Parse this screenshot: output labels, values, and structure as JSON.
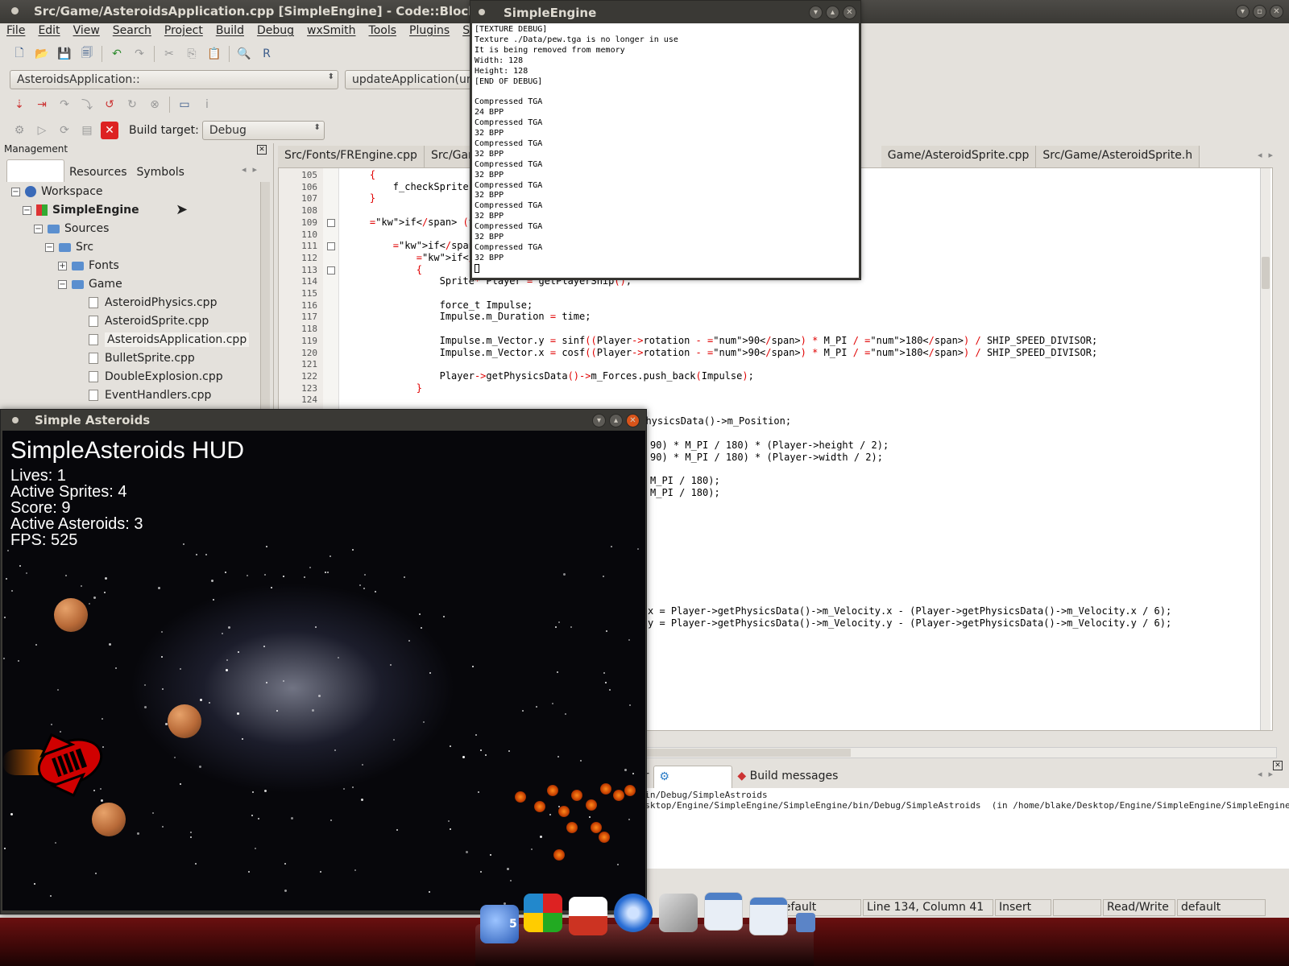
{
  "codeblocks": {
    "title": "Src/Game/AsteroidsApplication.cpp [SimpleEngine] - Code::Blocks 8.02",
    "menu": [
      "File",
      "Edit",
      "View",
      "Search",
      "Project",
      "Build",
      "Debug",
      "wxSmith",
      "Tools",
      "Plugins",
      "Setti"
    ],
    "scope_combo": "AsteroidsApplication::",
    "function_combo": "updateApplication(uns",
    "build_target_label": "Build target:",
    "build_target_value": "Debug",
    "management": {
      "header": "Management",
      "tabs": [
        "",
        "Resources",
        "Symbols"
      ],
      "tree": {
        "workspace": "Workspace",
        "project": "SimpleEngine",
        "sources": "Sources",
        "src": "Src",
        "fonts": "Fonts",
        "game": "Game",
        "files": [
          "AsteroidPhysics.cpp",
          "AsteroidSprite.cpp",
          "AsteroidsApplication.cpp",
          "BulletSprite.cpp",
          "DoubleExplosion.cpp",
          "EventHandlers.cpp"
        ]
      }
    },
    "editor_tabs": [
      "Src/Fonts/FREngine.cpp",
      "Src/Gam",
      "Game/AsteroidSprite.cpp",
      "Src/Game/AsteroidSprite.h"
    ],
    "line_numbers": [
      "105",
      "106",
      "107",
      "108",
      "109",
      "110",
      "111",
      "112",
      "113",
      "114",
      "115",
      "116",
      "117",
      "118",
      "119",
      "120",
      "121",
      "122",
      "123",
      "124"
    ],
    "code_lines": [
      "    {",
      "        f_checkSprite(",
      "    }",
      "",
      "    if (time != 0) {",
      "",
      "        if (m_upPresse",
      "            if (getPla",
      "            {",
      "                Sprite* Player = getPlayerShip();",
      "",
      "                force_t Impulse;",
      "                Impulse.m_Duration = time;",
      "",
      "                Impulse.m_Vector.y = sinf((Player->rotation - 90) * M_PI / 180) / SHIP_SPEED_DIVISOR;",
      "                Impulse.m_Vector.x = cosf((Player->rotation - 90) * M_PI / 180) / SHIP_SPEED_DIVISOR;",
      "",
      "                Player->getPhysicsData()->m_Forces.push_back(Impulse);",
      "            }",
      ""
    ],
    "code_fragments": [
      "tPhysicsData()->m_Position;",
      "90) * M_PI / 180) * (Player->height / 2);",
      "90) * M_PI / 180) * (Player->width / 2);",
      "M_PI / 180);",
      "M_PI / 180);",
      "x = Player->getPhysicsData()->m_Velocity.x - (Player->getPhysicsData()->m_Velocity.x / 6);",
      "y = Player->getPhysicsData()->m_Velocity.y - (Player->getPhysicsData()->m_Velocity.y / 6);"
    ],
    "logs": {
      "tabs": [
        "er",
        "",
        "Build messages"
      ],
      "lines": [
        "/bin/Debug/SimpleAstroids",
        "Desktop/Engine/SimpleEngine/SimpleEngine/bin/Debug/SimpleAstroids  (in /home/blake/Desktop/Engine/SimpleEngine/SimpleEngine/bin/"
      ]
    },
    "status": [
      "default",
      "Line 134, Column 41",
      "Insert",
      "",
      "Read/Write",
      "default"
    ]
  },
  "terminal": {
    "title": "SimpleEngine",
    "lines": [
      "[TEXTURE DEBUG]",
      "Texture ./Data/pew.tga is no longer in use",
      "It is being removed from memory",
      "Width: 128",
      "Height: 128",
      "[END OF DEBUG]",
      "",
      "Compressed TGA",
      "24 BPP",
      "Compressed TGA",
      "32 BPP",
      "Compressed TGA",
      "32 BPP",
      "Compressed TGA",
      "32 BPP",
      "Compressed TGA",
      "32 BPP",
      "Compressed TGA",
      "32 BPP",
      "Compressed TGA",
      "32 BPP",
      "Compressed TGA",
      "32 BPP"
    ]
  },
  "game": {
    "title": "Simple Asteroids",
    "hud_title": "SimpleAsteroids HUD",
    "lives": "Lives: 1",
    "sprites": "Active Sprites: 4",
    "score": "Score: 9",
    "asteroids": "Active Asteroids: 3",
    "fps": "FPS: 525"
  },
  "dock": {
    "badge": "5",
    "items": [
      "tasks-icon",
      "apps-icon",
      "home-folder-icon",
      "browser-icon",
      "image-viewer-icon",
      "window-icon",
      "window-icon",
      "bug-icon"
    ]
  }
}
